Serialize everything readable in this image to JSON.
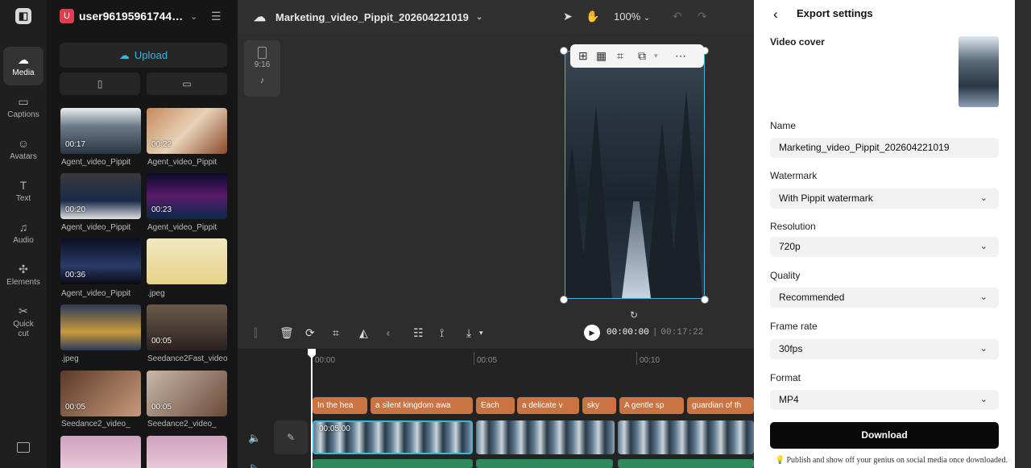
{
  "rail": {
    "items": [
      {
        "label": "Media",
        "icon": "media-icon"
      },
      {
        "label": "Captions",
        "icon": "captions-icon"
      },
      {
        "label": "Avatars",
        "icon": "avatars-icon"
      },
      {
        "label": "Text",
        "icon": "text-icon"
      },
      {
        "label": "Audio",
        "icon": "audio-icon"
      },
      {
        "label": "Elements",
        "icon": "elements-icon"
      },
      {
        "label": "Quick",
        "label2": "cut",
        "icon": "quick-cut-icon"
      }
    ]
  },
  "panel": {
    "user_initial": "U",
    "username": "user9619596174455",
    "upload_label": "Upload",
    "assets": [
      {
        "name": "Agent_video_Pippit",
        "duration": "00:17"
      },
      {
        "name": "Agent_video_Pippit",
        "duration": "00:22"
      },
      {
        "name": "Agent_video_Pippit",
        "duration": "00:20"
      },
      {
        "name": "Agent_video_Pippit",
        "duration": "00:23"
      },
      {
        "name": "Agent_video_Pippit",
        "duration": "00:36"
      },
      {
        "name": ".jpeg",
        "duration": ""
      },
      {
        "name": ".jpeg",
        "duration": ""
      },
      {
        "name": "Seedance2Fast_video",
        "duration": "00:05"
      },
      {
        "name": "Seedance2_video_",
        "duration": "00:05"
      },
      {
        "name": "Seedance2_video_",
        "duration": "00:05"
      }
    ]
  },
  "editor": {
    "project_name": "Marketing_video_Pippit_202604221019",
    "zoom": "100%",
    "ratio": "9:16",
    "time_current": "00:00:00",
    "time_total": "00:17:22",
    "ruler": [
      "00:00",
      "00:05",
      "00:10"
    ],
    "clip_stamp": "00:05:00",
    "captions": [
      "In the hea",
      "a silent kingdom awa",
      "Each",
      "a delicate v",
      "sky",
      "A gentle sp",
      "guardian of th"
    ]
  },
  "export": {
    "title": "Export settings",
    "cover_label": "Video cover",
    "name_label": "Name",
    "name_value": "Marketing_video_Pippit_202604221019",
    "watermark_label": "Watermark",
    "watermark_value": "With Pippit watermark",
    "resolution_label": "Resolution",
    "resolution_value": "720p",
    "quality_label": "Quality",
    "quality_value": "Recommended",
    "framerate_label": "Frame rate",
    "framerate_value": "30fps",
    "format_label": "Format",
    "format_value": "MP4",
    "download_label": "Download",
    "tip": "Publish and show off your genius on social media once downloaded."
  },
  "colors": {
    "accent": "#3db5d4",
    "caption_clip": "#c97442",
    "download_bg": "#0a0a0a"
  }
}
